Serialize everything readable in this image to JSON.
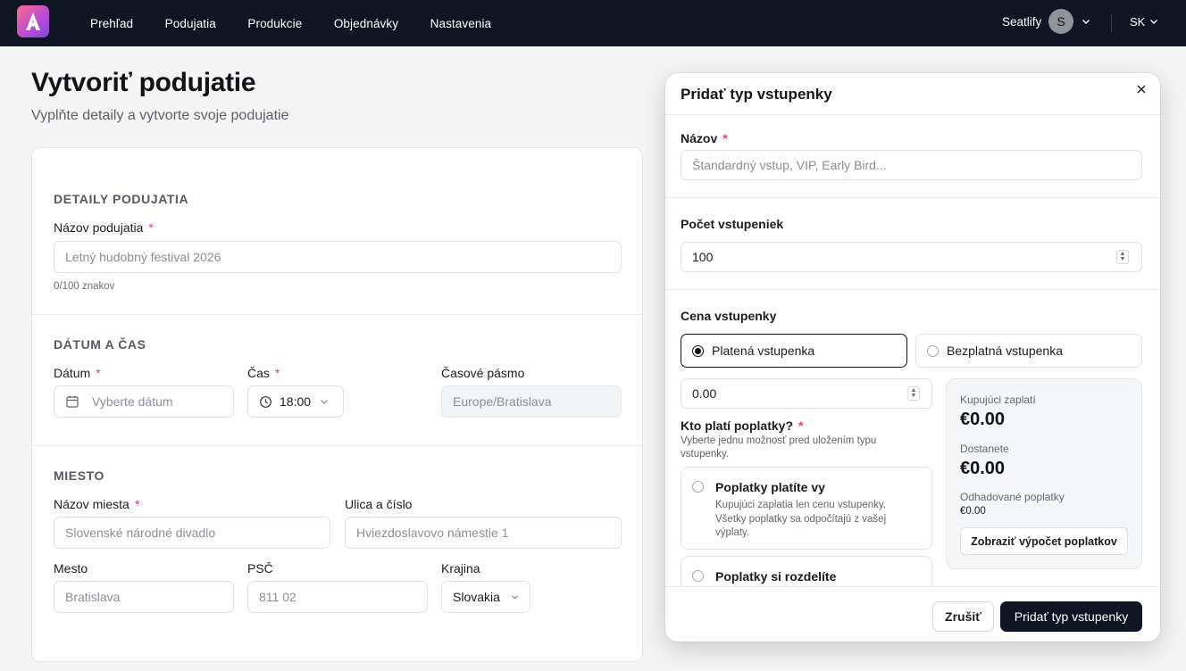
{
  "app": {
    "brand_color": "#0f1523",
    "accent": "#b64bd6"
  },
  "nav": {
    "items": [
      {
        "label": "Prehľad"
      },
      {
        "label": "Podujatia"
      },
      {
        "label": "Produkcie"
      },
      {
        "label": "Objednávky"
      },
      {
        "label": "Nastavenia"
      }
    ],
    "org_name": "Seatlify",
    "avatar_initial": "S",
    "language": "SK"
  },
  "page": {
    "title": "Vytvoriť podujatie",
    "subtitle": "Vyplňte detaily a vytvorte svoje podujatie"
  },
  "form": {
    "details": {
      "section_title": "DETAILY PODUJATIA",
      "name_label": "Názov podujatia",
      "name_placeholder": "Letný hudobný festival 2026",
      "char_count": "0/100 znakov"
    },
    "datetime": {
      "section_title": "DÁTUM A ČAS",
      "date_label": "Dátum",
      "date_placeholder": "Vyberte dátum",
      "time_label": "Čas",
      "time_value": "18:00",
      "tz_label": "Časové pásmo",
      "tz_value": "Europe/Bratislava"
    },
    "venue": {
      "section_title": "MIESTO",
      "venue_label": "Názov miesta",
      "venue_placeholder": "Slovenské národné divadlo",
      "street_label": "Ulica a číslo",
      "street_placeholder": "Hviezdoslavovo námestie 1",
      "city_label": "Mesto",
      "city_placeholder": "Bratislava",
      "zip_label": "PSČ",
      "zip_placeholder": "811 02",
      "country_label": "Krajina",
      "country_value": "Slovakia"
    }
  },
  "modal": {
    "title": "Pridať typ vstupenky",
    "name_label": "Názov",
    "name_placeholder": "Štandardný vstup, VIP, Early Bird...",
    "count_label": "Počet vstupeniek",
    "count_value": "100",
    "price_label": "Cena vstupenky",
    "paid_option": "Platená vstupenka",
    "free_option": "Bezplatná vstupenka",
    "price_value": "0.00",
    "fees_label": "Kto platí poplatky?",
    "fees_hint": "Vyberte jednu možnosť pred uložením typu vstupenky.",
    "fee_options": [
      {
        "title": "Poplatky platíte vy",
        "desc": "Kupujúci zaplatia len cenu vstupenky. Všetky poplatky sa odpočítajú z vašej výplaty."
      },
      {
        "title": "Poplatky si rozdelíte",
        "desc": ""
      }
    ],
    "summary": {
      "buyer_label": "Kupujúci zaplatí",
      "buyer_value": "€0.00",
      "receive_label": "Dostanete",
      "receive_value": "€0.00",
      "fees_label": "Odhadované poplatky",
      "fees_value": "€0.00",
      "button": "Zobraziť výpočet poplatkov"
    },
    "cancel": "Zrušiť",
    "submit": "Pridať typ vstupenky"
  }
}
